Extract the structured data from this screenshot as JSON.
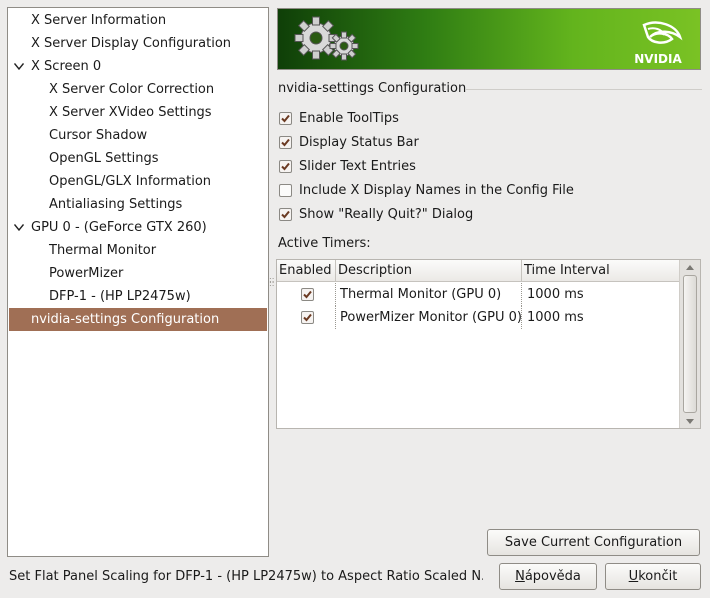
{
  "tree": {
    "items": [
      {
        "label": "X Server Information",
        "indent": 0,
        "expander": ""
      },
      {
        "label": "X Server Display Configuration",
        "indent": 0,
        "expander": ""
      },
      {
        "label": "X Screen 0",
        "indent": 0,
        "expander": "expanded"
      },
      {
        "label": "X Server Color Correction",
        "indent": 1,
        "expander": ""
      },
      {
        "label": "X Server XVideo Settings",
        "indent": 1,
        "expander": ""
      },
      {
        "label": "Cursor Shadow",
        "indent": 1,
        "expander": ""
      },
      {
        "label": "OpenGL Settings",
        "indent": 1,
        "expander": ""
      },
      {
        "label": "OpenGL/GLX Information",
        "indent": 1,
        "expander": ""
      },
      {
        "label": "Antialiasing Settings",
        "indent": 1,
        "expander": ""
      },
      {
        "label": "GPU 0 - (GeForce GTX 260)",
        "indent": 0,
        "expander": "expanded"
      },
      {
        "label": "Thermal Monitor",
        "indent": 1,
        "expander": ""
      },
      {
        "label": "PowerMizer",
        "indent": 1,
        "expander": ""
      },
      {
        "label": "DFP-1 - (HP LP2475w)",
        "indent": 1,
        "expander": ""
      },
      {
        "label": "nvidia-settings Configuration",
        "indent": 0,
        "expander": "",
        "selected": true
      }
    ],
    "selected_color": "#a06f55"
  },
  "banner": {
    "logo_text": "NVIDIA",
    "gear_icon": "gears-icon",
    "brand_icon": "nvidia-eye-icon",
    "accent": "#76b900"
  },
  "config": {
    "section_title": "nvidia-settings Configuration",
    "options": [
      {
        "label": "Enable ToolTips",
        "checked": true
      },
      {
        "label": "Display Status Bar",
        "checked": true
      },
      {
        "label": "Slider Text Entries",
        "checked": true
      },
      {
        "label": "Include X Display Names in the Config File",
        "checked": false
      },
      {
        "label": "Show \"Really Quit?\" Dialog",
        "checked": true
      }
    ],
    "timers_label": "Active Timers:",
    "table": {
      "headers": [
        "Enabled",
        "Description",
        "Time Interval"
      ],
      "rows": [
        {
          "enabled": true,
          "description": "Thermal Monitor (GPU 0)",
          "interval": "1000 ms"
        },
        {
          "enabled": true,
          "description": "PowerMizer Monitor (GPU 0)",
          "interval": "1000 ms"
        }
      ]
    },
    "save_button": "Save Current Configuration"
  },
  "status_bar": {
    "text": "Set Flat Panel Scaling for DFP-1 - (HP LP2475w) to Aspect Ratio Scaled N..."
  },
  "buttons": {
    "help_mnemonic": "N",
    "help_rest": "ápověda",
    "quit_mnemonic": "U",
    "quit_rest": "končit"
  }
}
